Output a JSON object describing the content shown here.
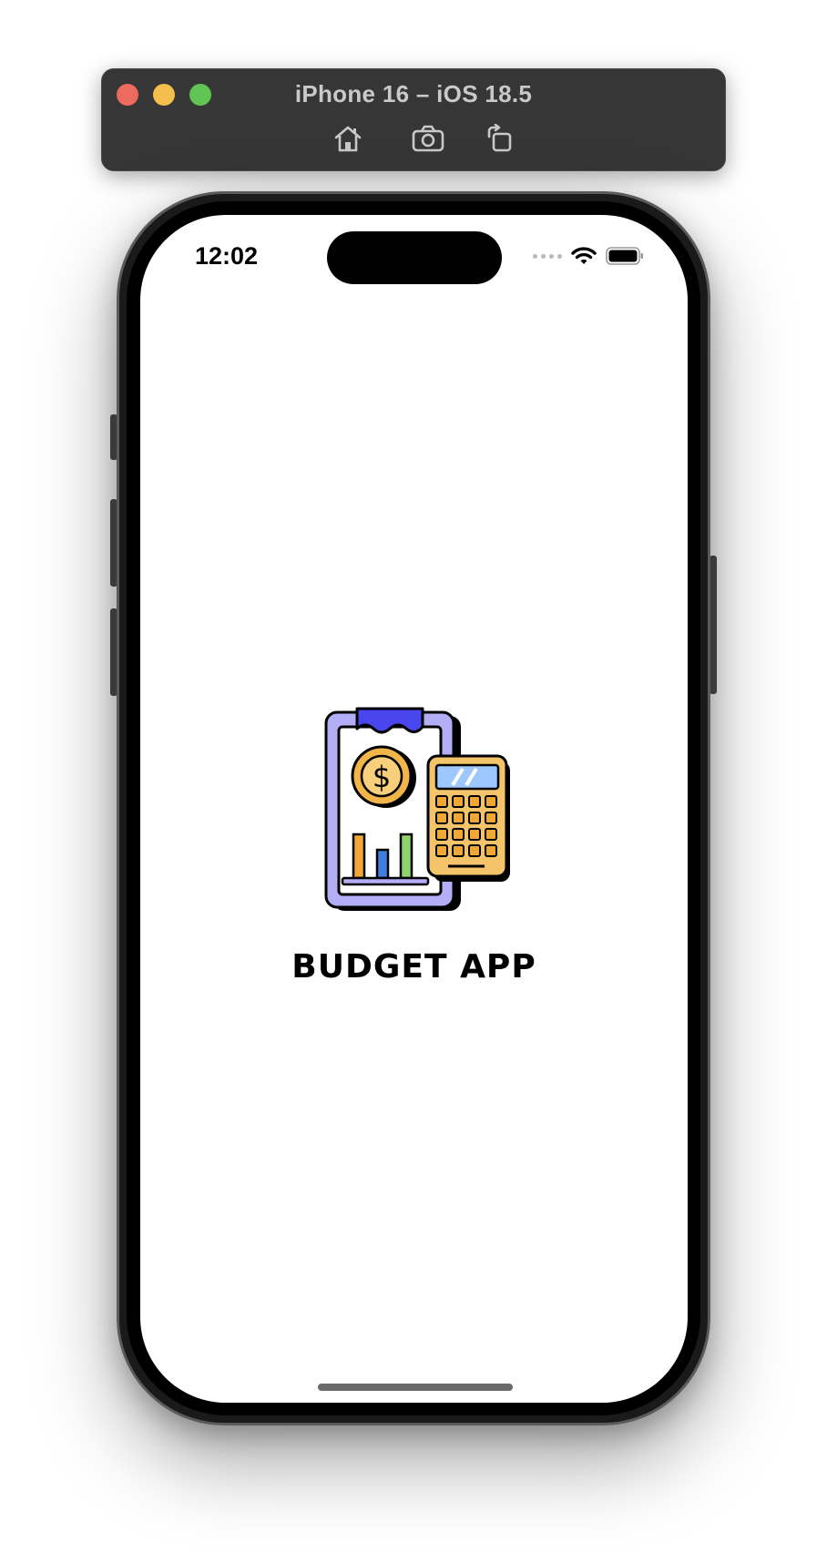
{
  "simulator": {
    "title": "iPhone 16 – iOS 18.5",
    "buttons": [
      {
        "icon": "home-icon",
        "label": "Home"
      },
      {
        "icon": "camera-icon",
        "label": "Screenshot"
      },
      {
        "icon": "rotate-icon",
        "label": "Rotate"
      }
    ],
    "traffic_colors": {
      "close": "#ed6a5e",
      "minimize": "#f5bf4f",
      "zoom": "#61c554"
    }
  },
  "status_bar": {
    "time": "12:02",
    "icons": [
      "signal-dots-icon",
      "wifi-icon",
      "battery-icon"
    ]
  },
  "app": {
    "title": "BUDGET APP",
    "logo_icon": "budget-clipboard-calculator-icon",
    "colors": {
      "clipboard": "#b3aef5",
      "clip": "#4a46ee",
      "coin": "#f2b54a",
      "bar_orange": "#f0a735",
      "bar_blue": "#3f7fe0",
      "bar_green": "#8fd36a",
      "calculator": "#f4c46a",
      "screen": "#9cc8ff"
    }
  }
}
